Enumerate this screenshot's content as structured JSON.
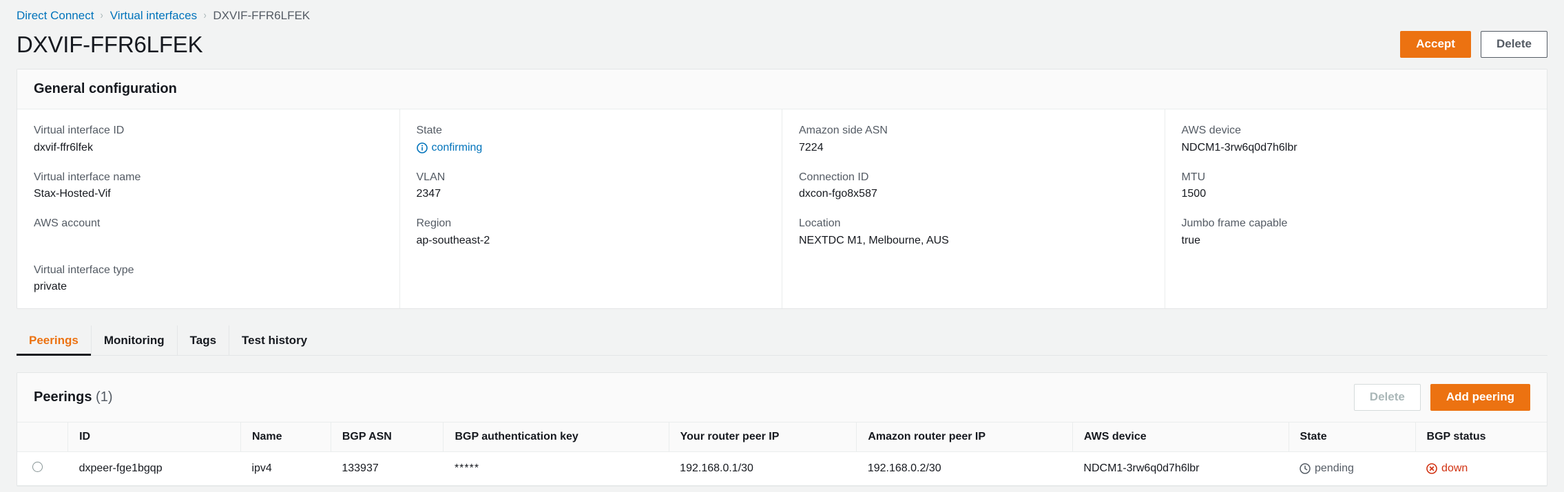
{
  "breadcrumb": {
    "items": [
      {
        "label": "Direct Connect",
        "type": "link"
      },
      {
        "label": "Virtual interfaces",
        "type": "link"
      },
      {
        "label": "DXVIF-FFR6LFEK",
        "type": "current"
      }
    ],
    "separator": "›"
  },
  "header": {
    "title": "DXVIF-FFR6LFEK",
    "accept_label": "Accept",
    "delete_label": "Delete"
  },
  "general_configuration": {
    "title": "General configuration",
    "columns": [
      {
        "fields": [
          {
            "label": "Virtual interface ID",
            "value": "dxvif-ffr6lfek"
          },
          {
            "label": "Virtual interface name",
            "value": "Stax-Hosted-Vif"
          },
          {
            "label": "AWS account",
            "value": ""
          },
          {
            "label": "Virtual interface type",
            "value": "private"
          }
        ]
      },
      {
        "fields": [
          {
            "label": "State",
            "value": "confirming",
            "icon": "info-icon",
            "style": "link"
          },
          {
            "label": "VLAN",
            "value": "2347"
          },
          {
            "label": "Region",
            "value": "ap-southeast-2"
          }
        ]
      },
      {
        "fields": [
          {
            "label": "Amazon side ASN",
            "value": "7224"
          },
          {
            "label": "Connection ID",
            "value": "dxcon-fgo8x587"
          },
          {
            "label": "Location",
            "value": "NEXTDC M1, Melbourne, AUS"
          }
        ]
      },
      {
        "fields": [
          {
            "label": "AWS device",
            "value": "NDCM1-3rw6q0d7h6lbr"
          },
          {
            "label": "MTU",
            "value": "1500"
          },
          {
            "label": "Jumbo frame capable",
            "value": "true"
          }
        ]
      }
    ]
  },
  "tabs": [
    {
      "label": "Peerings",
      "active": true
    },
    {
      "label": "Monitoring",
      "active": false
    },
    {
      "label": "Tags",
      "active": false
    },
    {
      "label": "Test history",
      "active": false
    }
  ],
  "peerings": {
    "title": "Peerings",
    "count": "(1)",
    "delete_label": "Delete",
    "add_label": "Add peering",
    "columns": [
      "ID",
      "Name",
      "BGP ASN",
      "BGP authentication key",
      "Your router peer IP",
      "Amazon router peer IP",
      "AWS device",
      "State",
      "BGP status"
    ],
    "rows": [
      {
        "id": "dxpeer-fge1bgqp",
        "name": "ipv4",
        "bgp_asn": "133937",
        "bgp_auth_key": "*****",
        "your_router_peer_ip": "192.168.0.1/30",
        "amazon_router_peer_ip": "192.168.0.2/30",
        "aws_device": "NDCM1-3rw6q0d7h6lbr",
        "state": "pending",
        "state_icon": "clock-icon",
        "bgp_status": "down",
        "bgp_status_icon": "error-circle-icon"
      }
    ]
  },
  "colors": {
    "accent_orange": "#ec7211",
    "link_blue": "#0073bb",
    "text_dark": "#16191f",
    "text_muted": "#545b64",
    "error_red": "#d13212",
    "page_bg": "#f2f3f3"
  }
}
